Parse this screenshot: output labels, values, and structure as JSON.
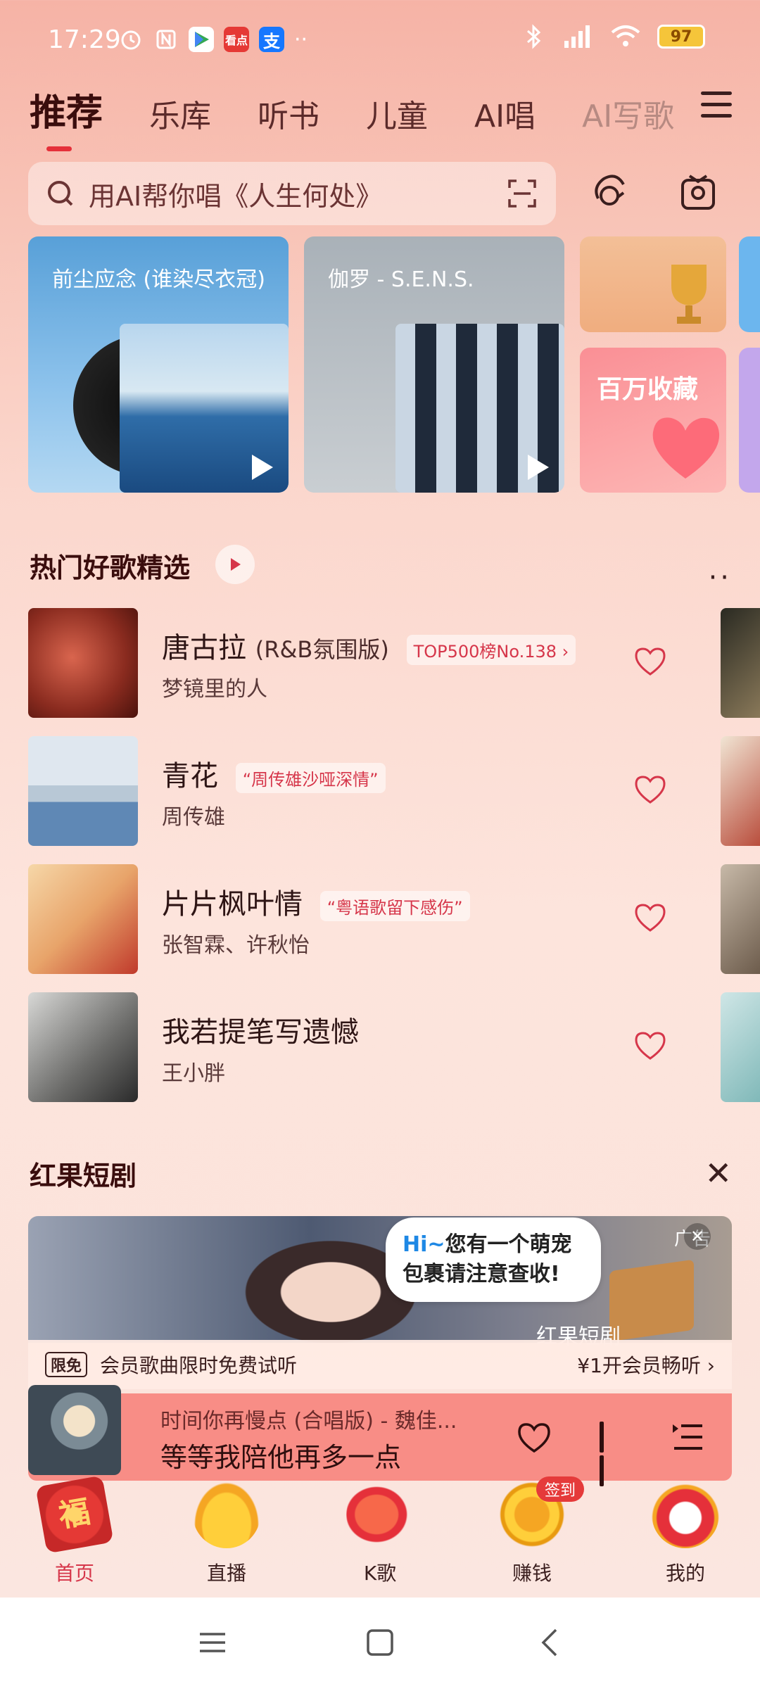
{
  "status_bar": {
    "time": "17:29",
    "battery": "97",
    "app_icons": [
      "alarm-icon",
      "nfc-icon",
      "play-icon",
      "kandian-app-icon",
      "alipay-icon"
    ],
    "more": "··"
  },
  "tabs": [
    "推荐",
    "乐库",
    "听书",
    "儿童",
    "AI唱",
    "AI写歌"
  ],
  "search": {
    "placeholder": "用AI帮你唱《人生何处》"
  },
  "cards": [
    {
      "subtitle": "前尘应念 (谁染尽衣冠)"
    },
    {
      "subtitle": "伽罗 - S.E.N.S."
    },
    {
      "title": "百万收藏"
    }
  ],
  "hot_songs": {
    "title": "热门好歌精选",
    "more": "··",
    "items": [
      {
        "title": "唐古拉",
        "version": "(R&B氛围版)",
        "tag": "TOP500榜No.138 ›",
        "artist": "梦镜里的人"
      },
      {
        "title": "青花",
        "version": "",
        "tag": "“周传雄沙哑深情”",
        "artist": "周传雄"
      },
      {
        "title": "片片枫叶情",
        "version": "",
        "tag": "“粤语歌留下感伤”",
        "artist": "张智霖、许秋怡"
      },
      {
        "title": "我若提笔写遗憾",
        "version": "",
        "tag": "",
        "artist": "王小胖"
      }
    ]
  },
  "drama": {
    "title": "红果短剧",
    "ad_label": "广告",
    "bubble_hi": "Hi~",
    "bubble_line1": "您有一个萌宠",
    "bubble_line2": "包裹请注意查收!",
    "banner_sub": "红果短剧"
  },
  "promo": {
    "badge": "限免",
    "text": "会员歌曲限时免费试听",
    "right": "¥1开会员畅听 ›"
  },
  "player": {
    "line1": "时间你再慢点 (合唱版) - 魏佳...",
    "line2": "等等我陪他再多一点"
  },
  "bottom_nav": [
    {
      "label": "首页",
      "icon": "fu-icon",
      "active": true
    },
    {
      "label": "直播",
      "icon": "gold-ingot-icon"
    },
    {
      "label": "K歌",
      "icon": "koi-fish-icon"
    },
    {
      "label": "赚钱",
      "icon": "coin-icon",
      "badge": "签到"
    },
    {
      "label": "我的",
      "icon": "lion-dance-icon"
    }
  ],
  "colors": {
    "accent": "#e5303a",
    "player_bg": "#f88d86",
    "tag": "#d6364a"
  }
}
